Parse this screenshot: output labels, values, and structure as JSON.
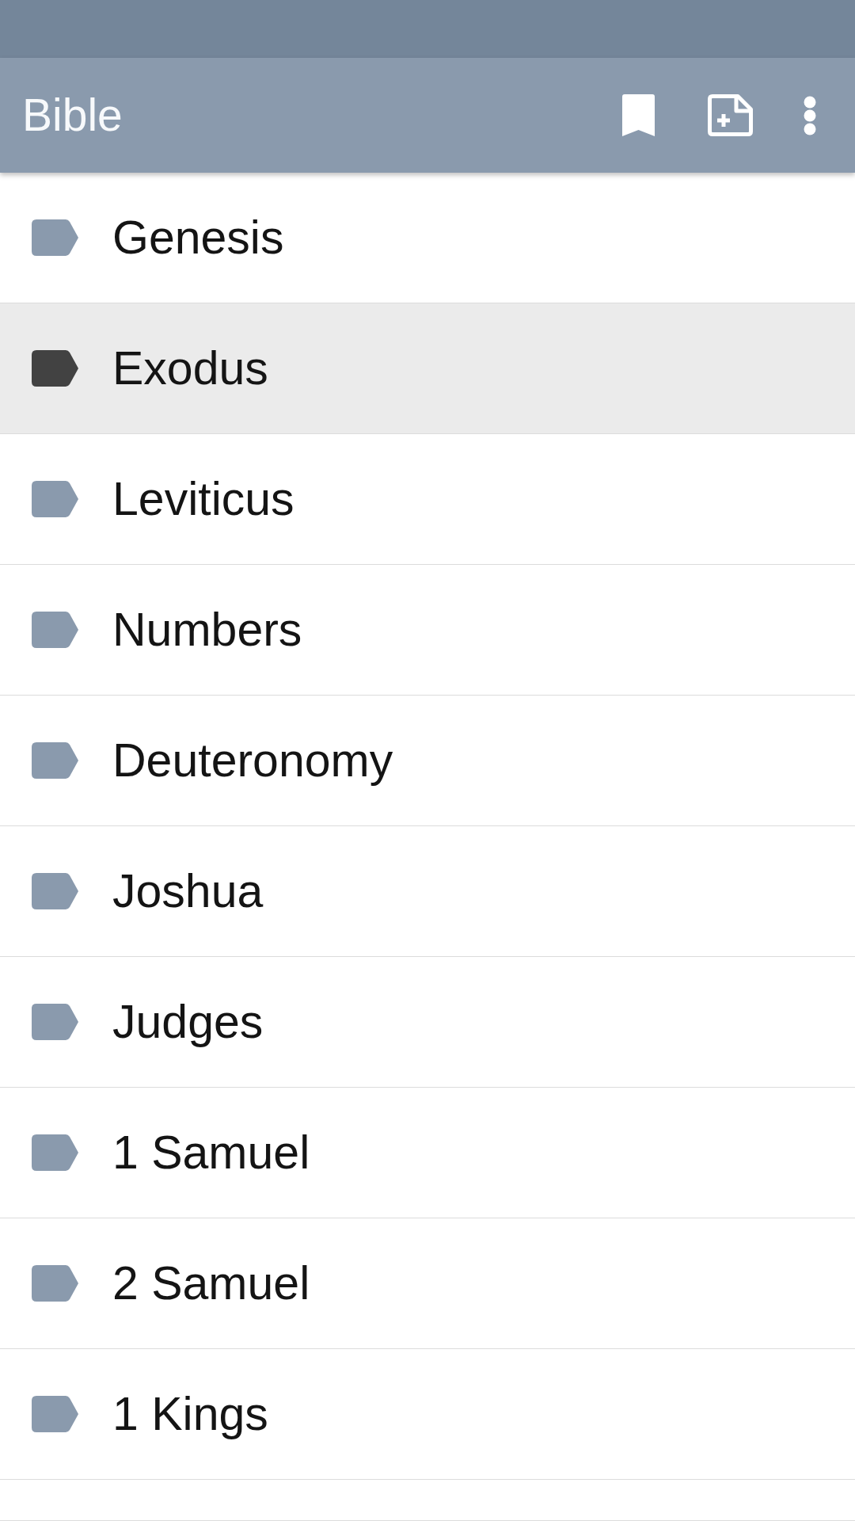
{
  "app_bar": {
    "title": "Bible"
  },
  "books": [
    {
      "name": "Genesis",
      "selected": false
    },
    {
      "name": "Exodus",
      "selected": true
    },
    {
      "name": "Leviticus",
      "selected": false
    },
    {
      "name": "Numbers",
      "selected": false
    },
    {
      "name": "Deuteronomy",
      "selected": false
    },
    {
      "name": "Joshua",
      "selected": false
    },
    {
      "name": "Judges",
      "selected": false
    },
    {
      "name": "1 Samuel",
      "selected": false
    },
    {
      "name": "2 Samuel",
      "selected": false
    },
    {
      "name": "1 Kings",
      "selected": false
    }
  ]
}
